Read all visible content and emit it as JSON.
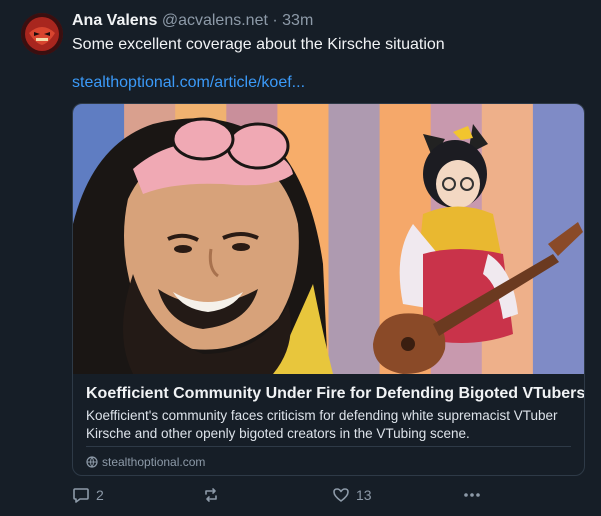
{
  "post": {
    "author_name": "Ana Valens",
    "handle": "@acvalens.net",
    "separator": "·",
    "time": "33m",
    "text": "Some excellent coverage about the Kirsche situation",
    "link_text": "stealthoptional.com/article/koef..."
  },
  "card": {
    "title": "Koefficient Community Under Fire for Defending Bigoted VTubers",
    "description": "Koefficient's community faces criticism for defending white supremacist VTuber Kirsche and other openly bigoted creators in the VTubing scene.",
    "source": "stealthoptional.com",
    "stripe_colors": [
      "#5f7dc2",
      "#d9a08e",
      "#f0b270",
      "#c98f9b",
      "#f7ad6a",
      "#ae9ab0",
      "#f5a86a",
      "#c899ae",
      "#eeb08a",
      "#7f8bc6"
    ]
  },
  "actions": {
    "reply_count": "2",
    "repost_count": "",
    "like_count": "13"
  },
  "colors": {
    "background": "#161e27",
    "link": "#3b9af8",
    "muted": "#8d9aa8"
  },
  "icons": [
    "reply-icon",
    "repost-icon",
    "like-icon",
    "more-icon",
    "globe-icon"
  ]
}
